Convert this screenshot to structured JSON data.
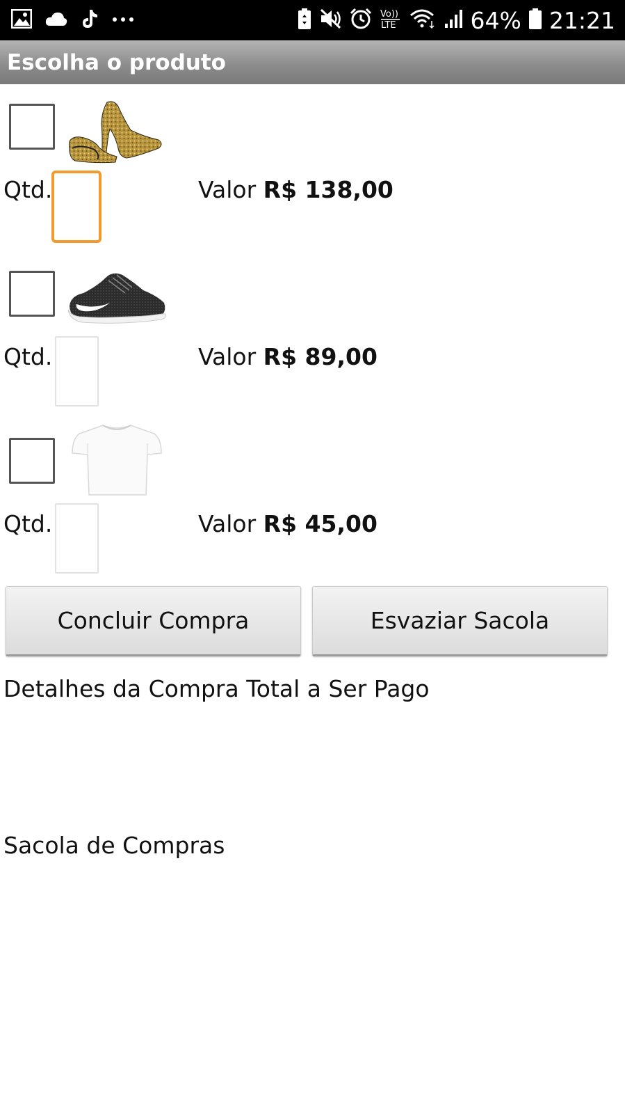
{
  "status_bar": {
    "battery": "64%",
    "time": "21:21",
    "left_icons": [
      "image-icon",
      "cloud-icon",
      "tiktok-icon",
      "more-icon"
    ],
    "right_icons": [
      "battery-saver-icon",
      "mute-icon",
      "alarm-icon",
      "volte-icon",
      "wifi-icon",
      "signal-icon",
      "battery-icon"
    ],
    "volte_text": "Vo)) LTE"
  },
  "header": {
    "title": "Escolha o produto"
  },
  "products": [
    {
      "icon": "high-heel-icon",
      "qty_label": "Qtd.",
      "qty_value": "",
      "price_label": "Valor",
      "price": "R$ 138,00"
    },
    {
      "icon": "sneaker-icon",
      "qty_label": "Qtd.",
      "qty_value": "",
      "price_label": "Valor",
      "price": "R$ 89,00"
    },
    {
      "icon": "tshirt-icon",
      "qty_label": "Qtd.",
      "qty_value": "",
      "price_label": "Valor",
      "price": "R$ 45,00"
    }
  ],
  "actions": {
    "checkout_label": "Concluir Compra",
    "empty_label": "Esvaziar Sacola"
  },
  "details": {
    "label": "Detalhes da Compra Total a Ser Pago"
  },
  "bag": {
    "label": "Sacola de Compras"
  },
  "colors": {
    "focus_border": "#f29a2e",
    "title_bar": "#8a8a8a",
    "status_bar": "#000000"
  }
}
